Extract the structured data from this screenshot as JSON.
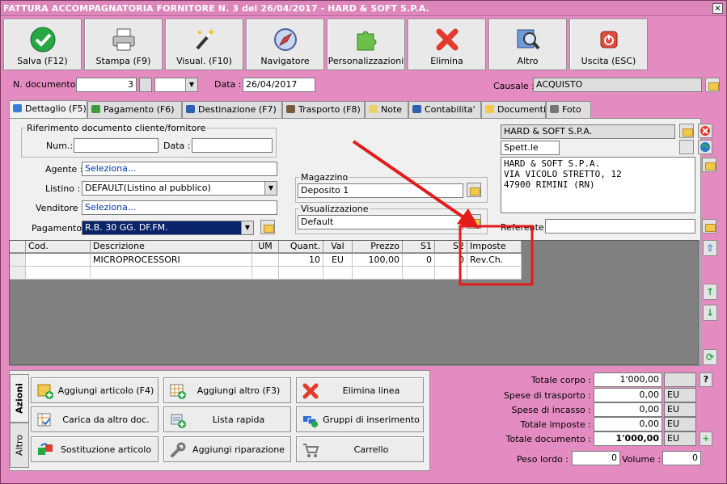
{
  "window": {
    "title": "FATTURA ACCOMPAGNATORIA FORNITORE N. 3 del 26/04/2017 - HARD & SOFT S.P.A.",
    "close": "×"
  },
  "toolbar": [
    {
      "label": "Salva (F12)",
      "icon": "check-icon"
    },
    {
      "label": "Stampa (F9)",
      "icon": "printer-icon"
    },
    {
      "label": "Visual. (F10)",
      "icon": "magic-wand-icon"
    },
    {
      "label": "Navigatore",
      "icon": "compass-icon"
    },
    {
      "label": "Personalizzazioni",
      "icon": "puzzle-icon"
    },
    {
      "label": "Elimina",
      "icon": "delete-x-icon"
    },
    {
      "label": "Altro",
      "icon": "magnifier-icon"
    },
    {
      "label": "Uscita (ESC)",
      "icon": "power-icon"
    }
  ],
  "header": {
    "doc_number_label": "N. documento :",
    "doc_number": "3",
    "date_label": "Data :",
    "date": "26/04/2017",
    "causale_label": "Causale :",
    "causale": "ACQUISTO"
  },
  "tabs": [
    {
      "label": "Dettaglio (F5)",
      "color": "#3a7bd5"
    },
    {
      "label": "Pagamento (F6)",
      "color": "#3d9b3d"
    },
    {
      "label": "Destinazione (F7)",
      "color": "#2f5fae"
    },
    {
      "label": "Trasporto (F8)",
      "color": "#7a5a3a"
    },
    {
      "label": "Note",
      "color": "#e8d36a"
    },
    {
      "label": "Contabilita'",
      "color": "#3060b0"
    },
    {
      "label": "Documenti",
      "color": "#f2c94c"
    },
    {
      "label": "Foto",
      "color": "#777777"
    }
  ],
  "riferimento": {
    "title": "Riferimento documento cliente/fornitore",
    "num_label": "Num.:",
    "num": "",
    "data_label": "Data :",
    "data": ""
  },
  "form": {
    "agente_label": "Agente :",
    "agente": "Seleziona...",
    "listino_label": "Listino :",
    "listino": "DEFAULT(Listino al pubblico)",
    "venditore_label": "Venditore :",
    "venditore": "Seleziona...",
    "pagamento_label": "Pagamento :",
    "pagamento": "R.B. 30 GG. DF.FM."
  },
  "magazzino": {
    "title": "Magazzino",
    "value": "Deposito 1"
  },
  "visualizzazione": {
    "title": "Visualizzazione",
    "value": "Default"
  },
  "fornitore": {
    "name": "HARD & SOFT S.P.A.",
    "salutation": "Spett.le",
    "address_lines": [
      "HARD & SOFT S.P.A.",
      "VIA VICOLO STRETTO, 12",
      "47900 RIMINI (RN)"
    ],
    "referente_label": "Referente",
    "referente": ""
  },
  "grid": {
    "columns": [
      "Cod.",
      "Descrizione",
      "UM",
      "Quant.",
      "Val",
      "Prezzo",
      "S1",
      "S2",
      "Imposte"
    ],
    "rows": [
      {
        "cod": "",
        "descrizione": "MICROPROCESSORI",
        "um": "",
        "quant": "10",
        "val": "EU",
        "prezzo": "100,00",
        "s1": "0",
        "s2": "0",
        "imposte": "Rev.Ch."
      }
    ]
  },
  "actions": {
    "tab_azioni": "Azioni",
    "tab_altro": "Altro",
    "buttons": [
      {
        "label": "Aggiungi articolo (F4)",
        "icon": "add-box-icon"
      },
      {
        "label": "Aggiungi altro (F3)",
        "icon": "add-grid-icon"
      },
      {
        "label": "Elimina linea",
        "icon": "delete-x-icon"
      },
      {
        "label": "Carica da altro doc.",
        "icon": "load-doc-icon"
      },
      {
        "label": "Lista rapida",
        "icon": "quick-list-icon"
      },
      {
        "label": "Gruppi di inserimento",
        "icon": "group-insert-icon"
      },
      {
        "label": "Sostituzione articolo",
        "icon": "replace-icon"
      },
      {
        "label": "Aggiungi riparazione",
        "icon": "wrench-icon"
      },
      {
        "label": "Carrello",
        "icon": "cart-icon"
      }
    ]
  },
  "totals": {
    "totale_corpo_label": "Totale corpo :",
    "totale_corpo": "1'000,00",
    "spese_trasporto_label": "Spese di trasporto :",
    "spese_trasporto": "0,00",
    "spese_incasso_label": "Spese di incasso :",
    "spese_incasso": "0,00",
    "totale_imposte_label": "Totale imposte :",
    "totale_imposte": "0,00",
    "totale_documento_label": "Totale documento :",
    "totale_documento": "1'000,00",
    "currency": "EU",
    "help": "?",
    "peso_lordo_label": "Peso lordo :",
    "peso_lordo": "0",
    "volume_label": "Volume :",
    "volume": "0"
  },
  "colors": {
    "accent_pink": "#e48cc2",
    "selection_blue": "#0a246a",
    "annotation_red": "#e31b1b"
  }
}
